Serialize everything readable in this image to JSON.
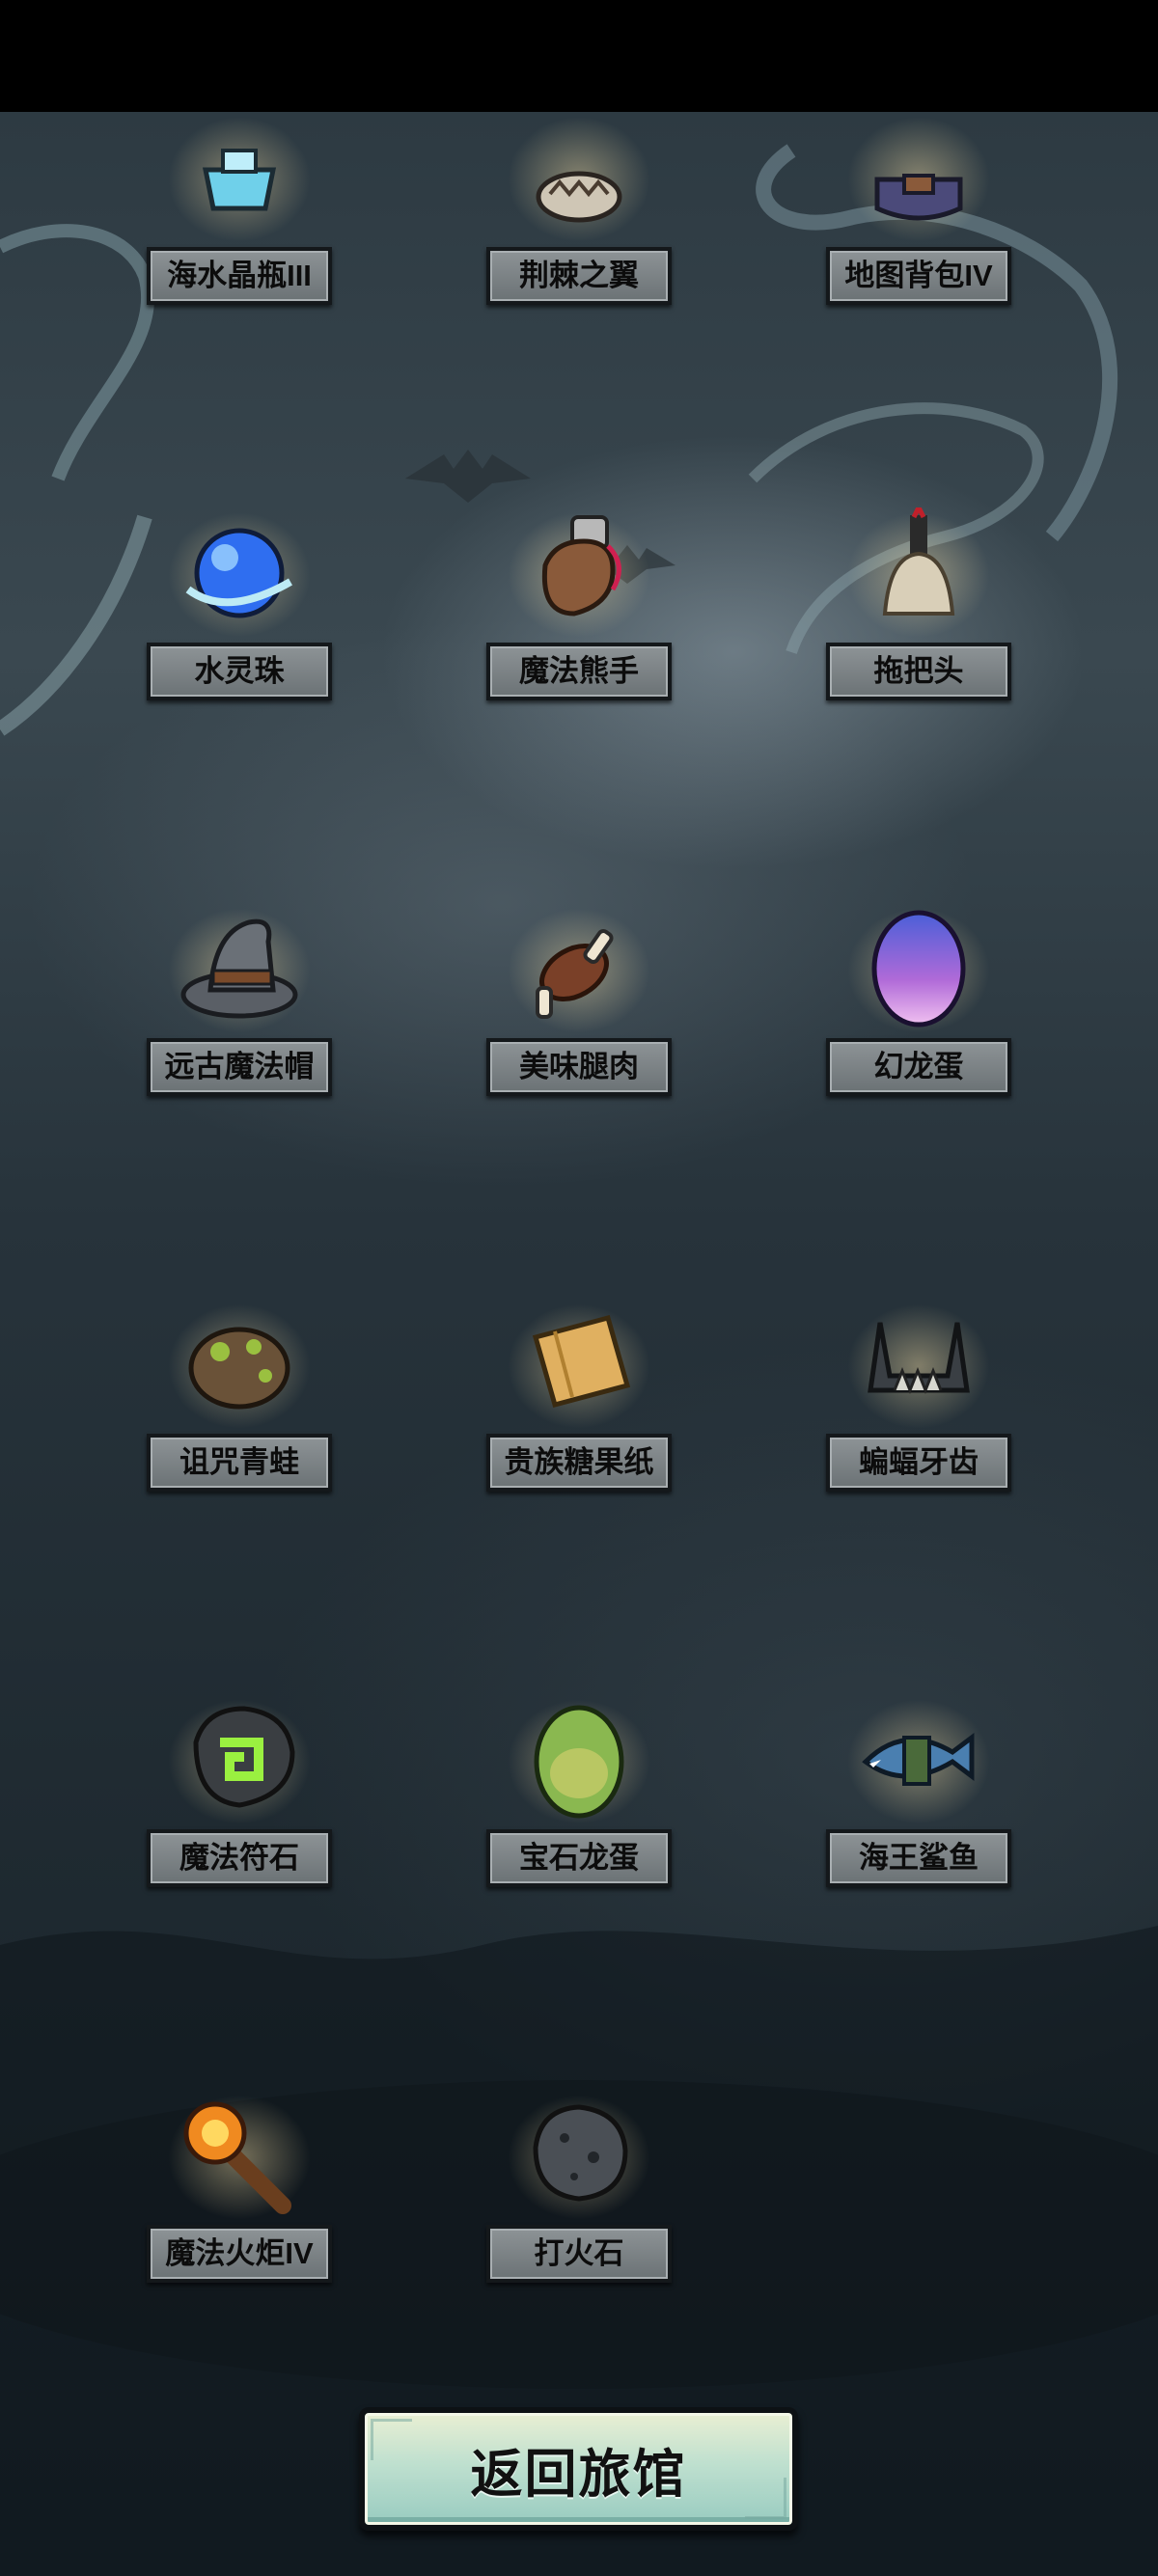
{
  "items": [
    {
      "name": "海水晶瓶III",
      "icon": "sea-crystal-bottle-icon"
    },
    {
      "name": "荆棘之翼",
      "icon": "thorn-wings-icon"
    },
    {
      "name": "地图背包IV",
      "icon": "map-backpack-icon"
    },
    {
      "name": "水灵珠",
      "icon": "water-spirit-orb-icon"
    },
    {
      "name": "魔法熊手",
      "icon": "magic-bear-paw-icon"
    },
    {
      "name": "拖把头",
      "icon": "mop-head-icon"
    },
    {
      "name": "远古魔法帽",
      "icon": "ancient-magic-hat-icon"
    },
    {
      "name": "美味腿肉",
      "icon": "tasty-leg-meat-icon"
    },
    {
      "name": "幻龙蛋",
      "icon": "phantom-dragon-egg-icon"
    },
    {
      "name": "诅咒青蛙",
      "icon": "cursed-frog-icon"
    },
    {
      "name": "贵族糖果纸",
      "icon": "noble-candy-wrapper-icon"
    },
    {
      "name": "蝙蝠牙齿",
      "icon": "bat-teeth-icon"
    },
    {
      "name": "魔法符石",
      "icon": "magic-rune-stone-icon"
    },
    {
      "name": "宝石龙蛋",
      "icon": "gem-dragon-egg-icon"
    },
    {
      "name": "海王鲨鱼",
      "icon": "sea-king-shark-icon"
    },
    {
      "name": "魔法火炬IV",
      "icon": "magic-torch-icon"
    },
    {
      "name": "打火石",
      "icon": "flint-stone-icon"
    }
  ],
  "return_button": {
    "label": "返回旅馆"
  }
}
